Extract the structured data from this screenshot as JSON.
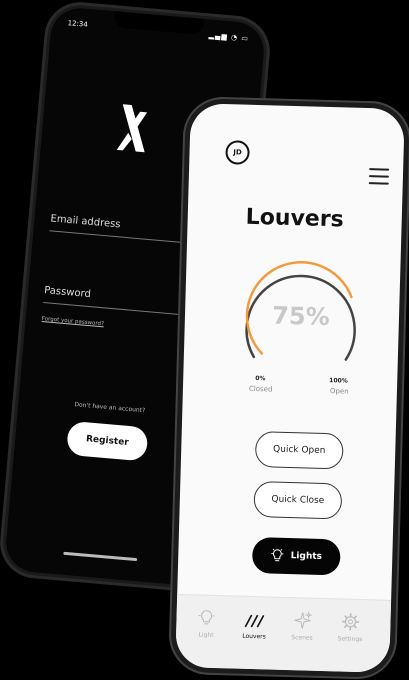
{
  "login": {
    "status_time": "12:34",
    "email_label": "Email address",
    "password_label": "Password",
    "forgot_link": "Forgot your password?",
    "no_account_text": "Don't have an account?",
    "register_label": "Register"
  },
  "louvers": {
    "avatar_initials": "JD",
    "title": "Louvers",
    "gauge_value": "75%",
    "gauge_fraction": 0.75,
    "min_label": "0%",
    "min_sub": "Closed",
    "max_label": "100%",
    "max_sub": "Open",
    "quick_open_label": "Quick Open",
    "quick_close_label": "Quick Close",
    "lights_label": "Lights",
    "accent_color": "#f39a3c",
    "tabs": [
      {
        "label": "Light",
        "icon": "bulb-icon"
      },
      {
        "label": "Louvers",
        "icon": "louvers-icon"
      },
      {
        "label": "Scenes",
        "icon": "sparkle-icon"
      },
      {
        "label": "Settings",
        "icon": "gear-icon"
      }
    ]
  }
}
